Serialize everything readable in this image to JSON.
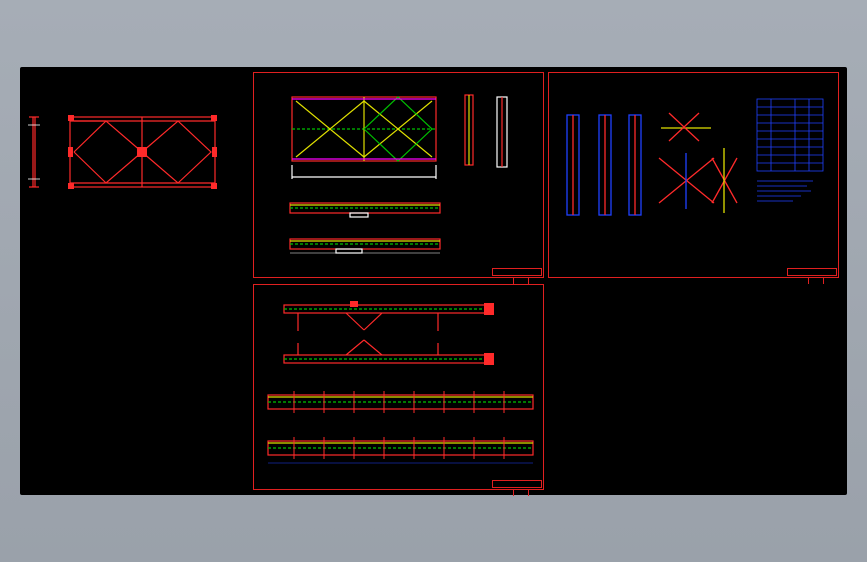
{
  "viewer": {
    "background_color": "#a6adb6",
    "canvas_color": "#000000",
    "line_colors": {
      "frame": "#e02020",
      "member": "#ff2a2a",
      "axis": "#00c000",
      "dimension": "#ffffff",
      "highlight": "#e0e000",
      "section": "#2040ff",
      "accent": "#ff00ff"
    }
  },
  "drawing": {
    "sheets": [
      {
        "id": "sheet-truss-panel-details",
        "drawing_icons": [
          "truss-elevation",
          "section-views",
          "chord-members"
        ]
      },
      {
        "id": "sheet-connection-details",
        "drawing_icons": [
          "column-sections",
          "cross-brace-joint",
          "parts-table"
        ]
      },
      {
        "id": "sheet-chord-assembly",
        "drawing_icons": [
          "chord-elevations",
          "brace-connections"
        ]
      }
    ],
    "overview": {
      "drawing_icons": [
        "truss-overview",
        "end-post"
      ]
    }
  }
}
